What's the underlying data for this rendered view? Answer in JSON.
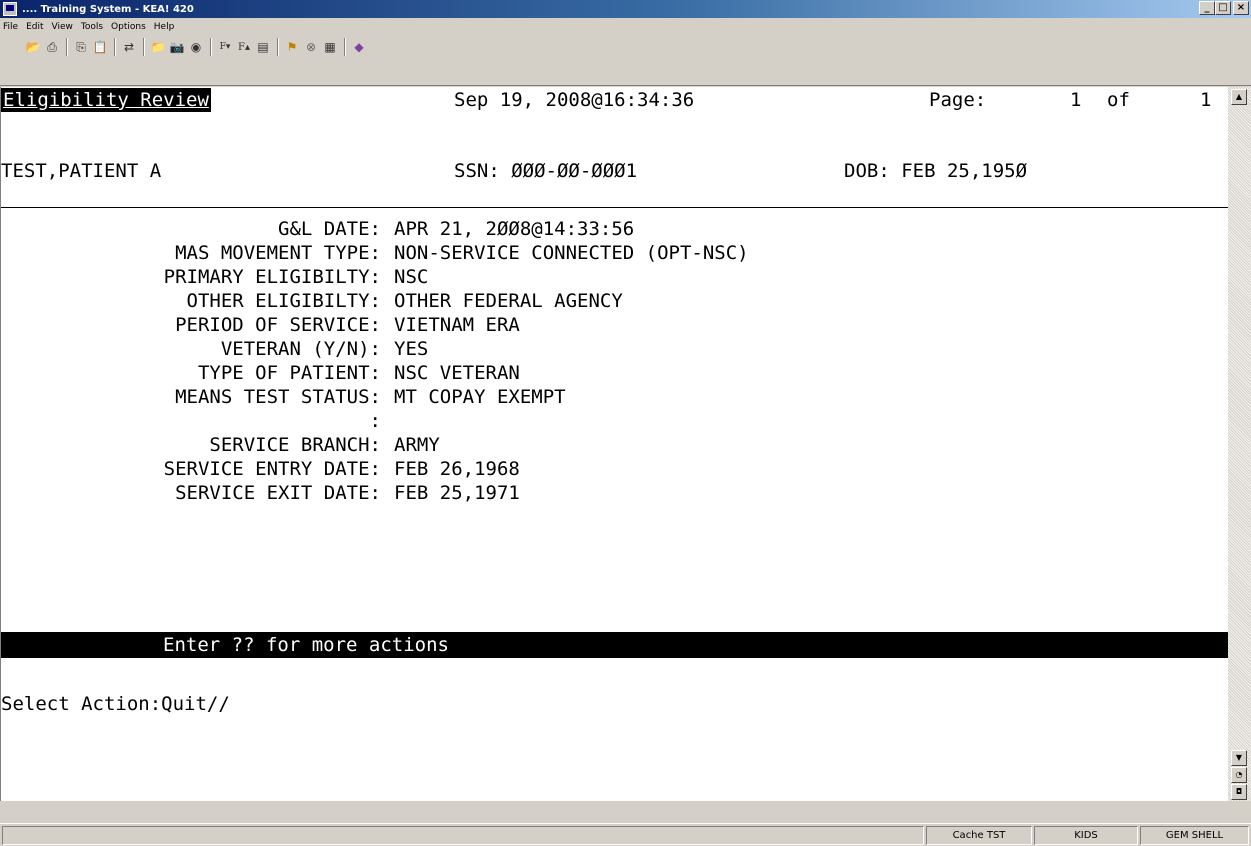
{
  "window": {
    "title": ".... Training System - KEA! 420",
    "minimize": "_",
    "maximize": "□",
    "close": "×"
  },
  "menu": [
    "File",
    "Edit",
    "View",
    "Tools",
    "Options",
    "Help"
  ],
  "toolbar_icons": [
    "open-icon",
    "print-icon",
    "copy-icon",
    "paste-icon",
    "connect-icon",
    "folder-icon",
    "camera-icon",
    "capture-icon",
    "font-down-icon",
    "font-up-icon",
    "printer-icon",
    "traffic-light-icon",
    "stop-icon",
    "keyboard-icon",
    "help-icon"
  ],
  "header": {
    "title": "Eligibility Review",
    "datetime": "Sep 19, 2008@16:34:36",
    "page_label": "Page:",
    "page_num": "1",
    "of_label": "of",
    "page_total": "1"
  },
  "patient": {
    "name": "TEST,PATIENT A",
    "ssn": "SSN: ØØØ-ØØ-ØØØ1",
    "dob": "DOB: FEB 25,195Ø"
  },
  "fields": [
    {
      "label": "G&L DATE:",
      "value": "APR 21, 2ØØ8@14:33:56"
    },
    {
      "label": "MAS MOVEMENT TYPE:",
      "value": "NON-SERVICE CONNECTED (OPT-NSC)"
    },
    {
      "label": "PRIMARY ELIGIBILTY:",
      "value": "NSC"
    },
    {
      "label": "OTHER ELIGIBILTY:",
      "value": "OTHER FEDERAL AGENCY"
    },
    {
      "label": "PERIOD OF SERVICE:",
      "value": "VIETNAM ERA"
    },
    {
      "label": "VETERAN (Y/N):",
      "value": "YES"
    },
    {
      "label": "TYPE OF PATIENT:",
      "value": "NSC VETERAN"
    },
    {
      "label": "MEANS TEST STATUS:",
      "value": "MT COPAY EXEMPT"
    },
    {
      "label": ":",
      "value": ""
    },
    {
      "label": "SERVICE BRANCH:",
      "value": "ARMY"
    },
    {
      "label": "SERVICE ENTRY DATE:",
      "value": "FEB 26,1968"
    },
    {
      "label": "SERVICE EXIT DATE:",
      "value": "FEB 25,1971"
    }
  ],
  "action_bar": "Enter ?? for more actions",
  "prompt": "Select Action:Quit//",
  "status": [
    "Cache TST",
    "KIDS",
    "GEM SHELL"
  ]
}
